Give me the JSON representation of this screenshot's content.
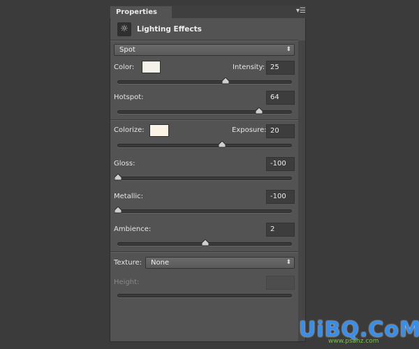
{
  "panel": {
    "tab": "Properties",
    "menu_icon": "panel-menu-icon",
    "title": "Lighting Effects",
    "icon": "light-sun-icon"
  },
  "light_type": "Spot",
  "color": {
    "label": "Color:",
    "value": "#f5f2ea"
  },
  "intensity": {
    "label": "Intensity:",
    "value": "25",
    "slider": 0.62
  },
  "hotspot": {
    "label": "Hotspot:",
    "value": "64",
    "slider": 0.815
  },
  "colorize": {
    "label": "Colorize:",
    "value": "#fbf3e6"
  },
  "exposure": {
    "label": "Exposure:",
    "value": "20",
    "slider": 0.6
  },
  "gloss": {
    "label": "Gloss:",
    "value": "-100",
    "slider": 0
  },
  "metallic": {
    "label": "Metallic:",
    "value": "-100",
    "slider": 0
  },
  "ambience": {
    "label": "Ambience:",
    "value": "2",
    "slider": 0.505
  },
  "texture": {
    "label": "Texture:",
    "value": "None"
  },
  "height": {
    "label": "Height:",
    "value": ""
  },
  "watermark": {
    "main": "UiBQ.CoM",
    "sub": "www.psahz.com"
  }
}
